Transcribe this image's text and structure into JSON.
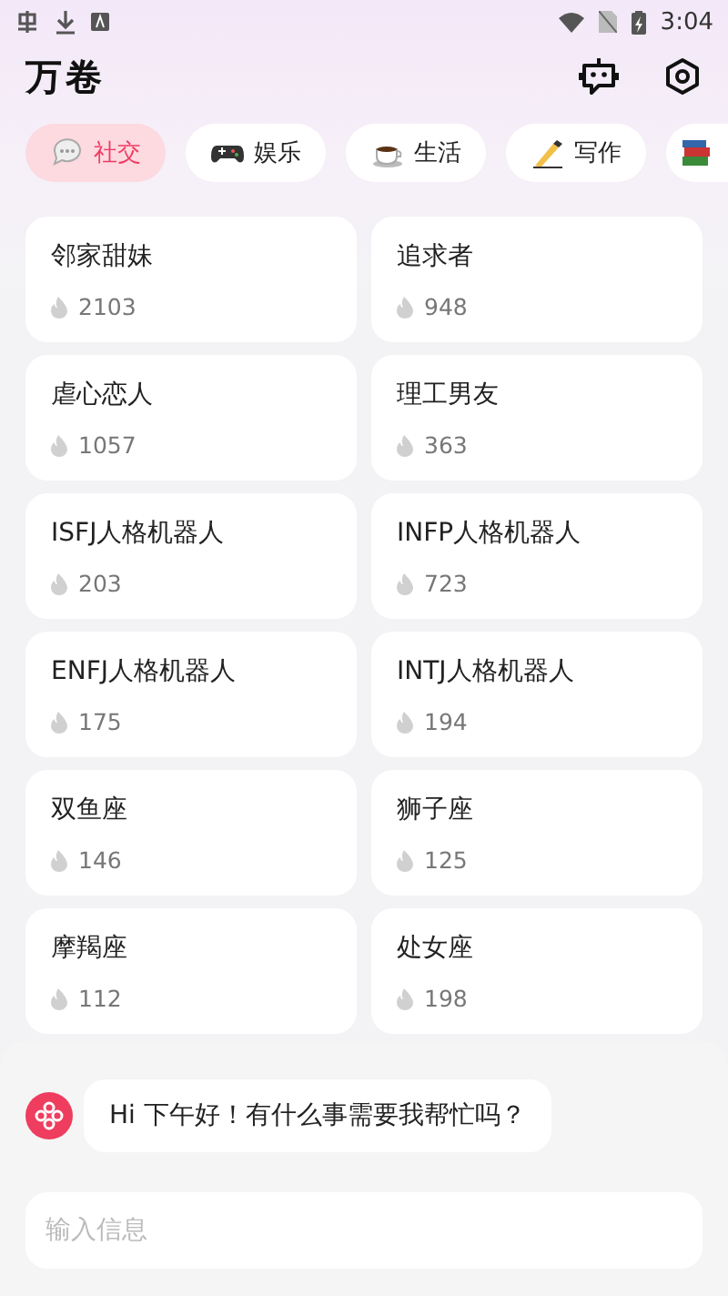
{
  "status_bar": {
    "time": "3:04"
  },
  "header": {
    "title": "万卷"
  },
  "tabs": [
    {
      "label": "社交",
      "selected": true
    },
    {
      "label": "娱乐",
      "selected": false
    },
    {
      "label": "生活",
      "selected": false
    },
    {
      "label": "写作",
      "selected": false
    },
    {
      "selected": false
    }
  ],
  "bots": [
    {
      "name": "邻家甜妹",
      "count": "2103"
    },
    {
      "name": "追求者",
      "count": "948"
    },
    {
      "name": "虐心恋人",
      "count": "1057"
    },
    {
      "name": "理工男友",
      "count": "363"
    },
    {
      "name": "ISFJ人格机器人",
      "count": "203"
    },
    {
      "name": "INFP人格机器人",
      "count": "723"
    },
    {
      "name": "ENFJ人格机器人",
      "count": "175"
    },
    {
      "name": "INTJ人格机器人",
      "count": "194"
    },
    {
      "name": "双鱼座",
      "count": "146"
    },
    {
      "name": "狮子座",
      "count": "125"
    },
    {
      "name": "摩羯座",
      "count": "112"
    },
    {
      "name": "处女座",
      "count": "198"
    }
  ],
  "chat": {
    "message": "Hi 下午好！有什么事需要我帮忙吗？",
    "input": {
      "placeholder": "输入信息"
    }
  }
}
